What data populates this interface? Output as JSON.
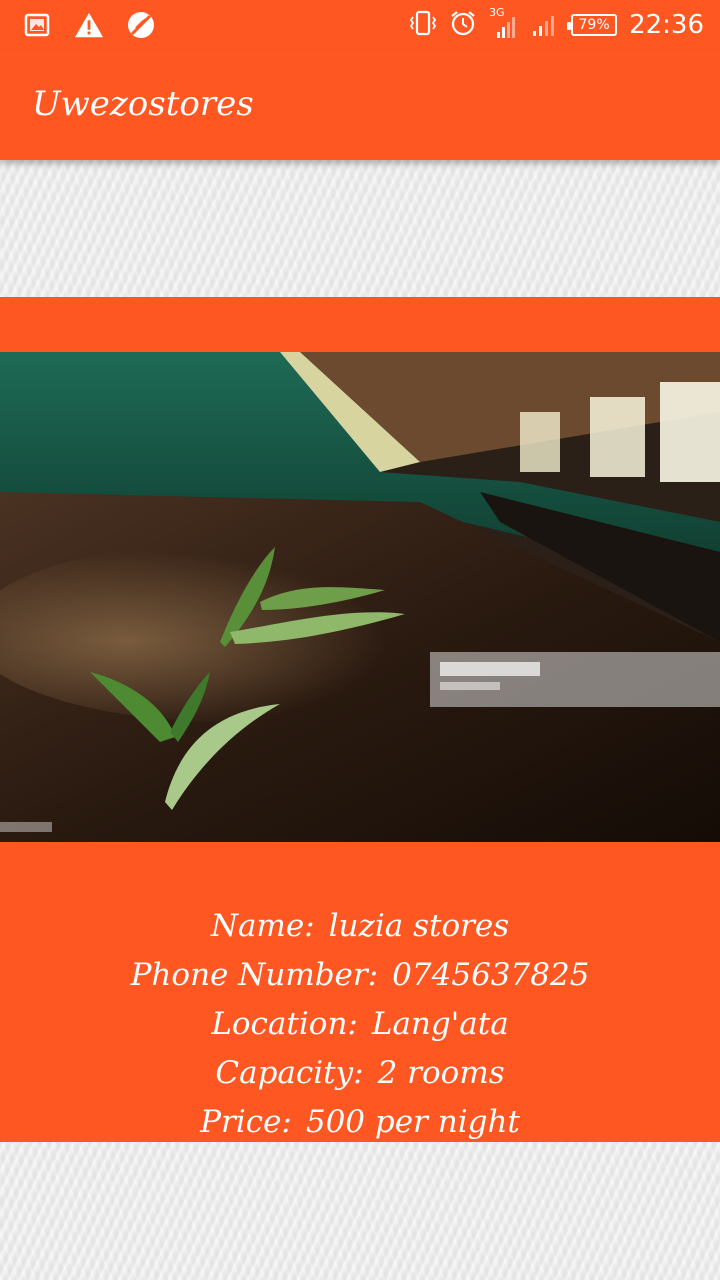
{
  "status_bar": {
    "left_icons": [
      "image-icon",
      "warning-icon",
      "no-sync-icon"
    ],
    "network_label": "3G",
    "battery_level": "79%",
    "time": "22:36"
  },
  "app": {
    "title": "Uwezostores"
  },
  "store": {
    "name_label": "Name:",
    "name_value": "luzia stores",
    "phone_label": "Phone Number:",
    "phone_value": "0745637825",
    "location_label": "Location:",
    "location_value": "Lang'ata",
    "capacity_label": "Capacity:",
    "capacity_value": "2 rooms",
    "price_label": "Price:",
    "price_value": "500 per night"
  },
  "colors": {
    "accent": "#ff5722"
  }
}
